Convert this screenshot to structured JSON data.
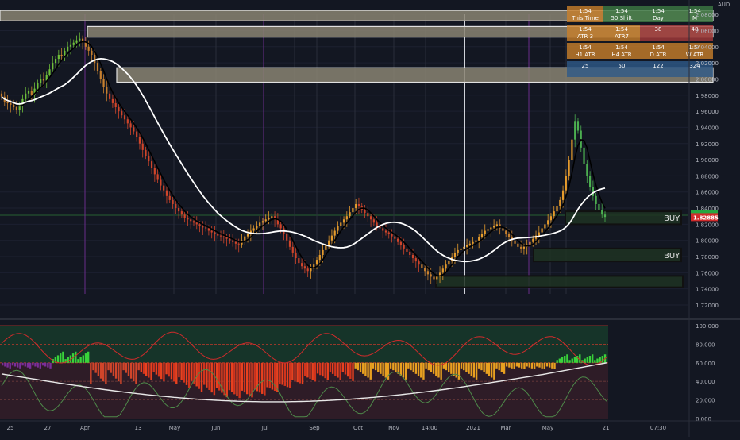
{
  "chart_data": {
    "type": "candlestick",
    "instrument_currency": "AUD",
    "price_axis": {
      "range": [
        1.72,
        2.09
      ],
      "ticks": [
        1.72,
        1.74,
        1.76,
        1.78,
        1.8,
        1.82,
        1.84,
        1.86,
        1.88,
        1.9,
        1.92,
        1.94,
        1.96,
        1.98,
        2.0,
        2.02,
        2.04,
        2.06,
        2.08
      ],
      "tick_labels": [
        "1.72000",
        "1.74000",
        "1.76000",
        "1.78000",
        "1.80000",
        "1.82000",
        "1.84000",
        "1.86000",
        "1.88000",
        "1.90000",
        "1.92000",
        "1.94000",
        "1.96000",
        "1.98000",
        "2.00000",
        "2.02000",
        "2.04000",
        "2.06000",
        "2.08000"
      ],
      "current_price": 1.82885,
      "current_price_label": "1.82885"
    },
    "oscillator_axis": {
      "range": [
        0,
        100
      ],
      "ticks": [
        0,
        20,
        40,
        60,
        80,
        100
      ],
      "tick_labels": [
        "0.000",
        "20.000",
        "40.000",
        "60.000",
        "80.000",
        "100.000"
      ]
    },
    "time_axis": {
      "labels": [
        "25",
        "27",
        "Apr",
        "13",
        "May",
        "Jun",
        "Jul",
        "Sep",
        "Oct",
        "Nov",
        "14:00",
        "2021",
        "Mar",
        "May",
        "21",
        "07:30"
      ]
    },
    "zones": [
      {
        "label": "",
        "top": 2.085,
        "bottom": 2.072,
        "color": "#8a8472"
      },
      {
        "label": "",
        "top": 2.065,
        "bottom": 2.052,
        "color": "#8a8472"
      },
      {
        "label": "",
        "top": 2.014,
        "bottom": 1.996,
        "color": "#8a8472"
      },
      {
        "label": "BUY",
        "top": 1.836,
        "bottom": 1.82,
        "color": "#1e3322"
      },
      {
        "label": "BUY",
        "top": 1.79,
        "bottom": 1.774,
        "color": "#1e3322"
      },
      {
        "label": "",
        "top": 1.756,
        "bottom": 1.742,
        "color": "#1e3322"
      }
    ],
    "info_table": [
      [
        {
          "text": "1:54",
          "sub": "This Time",
          "bg": "#c9802a"
        },
        {
          "text": "1:54",
          "sub": "50 Shift",
          "bg": "#3d7a44"
        },
        {
          "text": "1:54",
          "sub": "Day",
          "bg": "#3d7a44"
        },
        {
          "text": "1:54",
          "sub": "M",
          "bg": "#3d7a44"
        }
      ],
      [
        {
          "text": "1:54",
          "sub": "ATR 3",
          "bg": "#c9802a"
        },
        {
          "text": "1:54",
          "sub": "ATR7",
          "bg": "#c9802a"
        },
        {
          "text": "38",
          "sub": "",
          "bg": "#a63a3a"
        },
        {
          "text": "48",
          "sub": "",
          "bg": "#a63a3a"
        }
      ],
      [
        {
          "text": "1:54",
          "sub": "H1 ATR",
          "bg": "#c9802a"
        },
        {
          "text": "1:54",
          "sub": "H4 ATR",
          "bg": "#c9802a"
        },
        {
          "text": "1:54",
          "sub": "D ATR",
          "bg": "#c9802a"
        },
        {
          "text": "1:54",
          "sub": "W ATR",
          "bg": "#c9802a"
        }
      ],
      [
        {
          "text": "25",
          "sub": "",
          "bg": "#2e5a8a"
        },
        {
          "text": "50",
          "sub": "",
          "bg": "#2e5a8a"
        },
        {
          "text": "122",
          "sub": "",
          "bg": "#2e5a8a"
        },
        {
          "text": "324",
          "sub": "",
          "bg": "#2e5a8a"
        }
      ]
    ],
    "buy_labels": [
      "BUY",
      "BUY"
    ],
    "candles_close": [
      1.978,
      1.972,
      1.97,
      1.968,
      1.965,
      1.962,
      1.968,
      1.975,
      1.982,
      1.985,
      1.98,
      1.988,
      1.995,
      2.0,
      1.998,
      2.005,
      2.012,
      2.02,
      2.025,
      2.03,
      2.028,
      2.035,
      2.04,
      2.042,
      2.045,
      2.048,
      2.05,
      2.046,
      2.04,
      2.035,
      2.03,
      2.02,
      2.01,
      2.0,
      1.99,
      1.982,
      1.975,
      1.97,
      1.965,
      1.96,
      1.955,
      1.95,
      1.945,
      1.94,
      1.935,
      1.928,
      1.92,
      1.912,
      1.905,
      1.898,
      1.89,
      1.882,
      1.875,
      1.868,
      1.862,
      1.855,
      1.85,
      1.845,
      1.84,
      1.836,
      1.832,
      1.828,
      1.826,
      1.824,
      1.822,
      1.82,
      1.818,
      1.816,
      1.815,
      1.812,
      1.81,
      1.808,
      1.806,
      1.805,
      1.804,
      1.802,
      1.8,
      1.798,
      1.796,
      1.795,
      1.8,
      1.805,
      1.808,
      1.812,
      1.815,
      1.818,
      1.822,
      1.824,
      1.826,
      1.828,
      1.83,
      1.826,
      1.82,
      1.815,
      1.808,
      1.8,
      1.792,
      1.785,
      1.778,
      1.772,
      1.768,
      1.765,
      1.762,
      1.765,
      1.77,
      1.776,
      1.782,
      1.788,
      1.794,
      1.8,
      1.806,
      1.812,
      1.818,
      1.822,
      1.826,
      1.83,
      1.835,
      1.84,
      1.845,
      1.842,
      1.838,
      1.834,
      1.83,
      1.826,
      1.822,
      1.818,
      1.815,
      1.812,
      1.81,
      1.808,
      1.805,
      1.802,
      1.798,
      1.794,
      1.79,
      1.786,
      1.782,
      1.778,
      1.774,
      1.77,
      1.766,
      1.762,
      1.758,
      1.755,
      1.752,
      1.755,
      1.76,
      1.765,
      1.77,
      1.775,
      1.78,
      1.785,
      1.788,
      1.79,
      1.792,
      1.794,
      1.796,
      1.798,
      1.8,
      1.804,
      1.808,
      1.812,
      1.814,
      1.816,
      1.818,
      1.82,
      1.815,
      1.812,
      1.808,
      1.804,
      1.8,
      1.796,
      1.792,
      1.79,
      1.792,
      1.795,
      1.798,
      1.802,
      1.806,
      1.81,
      1.815,
      1.82,
      1.825,
      1.83,
      1.836,
      1.842,
      1.85,
      1.862,
      1.88,
      1.9,
      1.925,
      1.948,
      1.936,
      1.915,
      1.895,
      1.88,
      1.866,
      1.855,
      1.845,
      1.838,
      1.832,
      1.829
    ]
  }
}
